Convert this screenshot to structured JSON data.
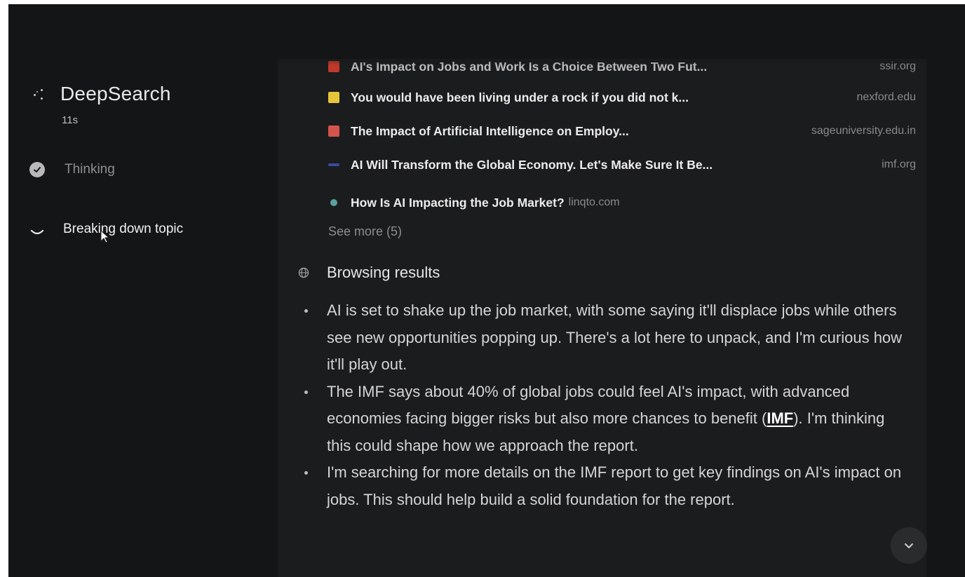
{
  "sidebar": {
    "app_title": "DeepSearch",
    "elapsed": "11s",
    "steps": [
      {
        "label": "Thinking",
        "state": "done"
      },
      {
        "label": "Breaking down topic",
        "state": "in-progress"
      }
    ]
  },
  "sources": [
    {
      "title": "AI's Impact on Jobs and Work Is a Choice Between Two Fut...",
      "domain": "ssir.org",
      "favicon_color": "#c0392b"
    },
    {
      "title": "You would have been living under a rock if you did not k...",
      "domain": "nexford.edu",
      "favicon_color": "#e7c53a"
    },
    {
      "title": "The Impact of Artificial Intelligence on Employ...",
      "domain": "sageuniversity.edu.in",
      "favicon_color": "#d4534a"
    },
    {
      "title": "AI Will Transform the Global Economy. Let's Make Sure It Be...",
      "domain": "imf.org",
      "favicon_color": "#3b4aa0"
    },
    {
      "title": "How Is AI Impacting the Job Market?",
      "domain": "linqto.com",
      "favicon_color": "#5aa0a0"
    }
  ],
  "see_more": "See more (5)",
  "browsing": {
    "label": "Browsing results",
    "icon": "globe-icon"
  },
  "bullets": [
    {
      "text": "AI is set to shake up the job market, with some saying it'll displace jobs while others see new opportunities popping up. There's a lot here to unpack, and I'm curious how it'll play out."
    },
    {
      "before": "The IMF says about 40% of global jobs could feel AI's impact, with advanced economies facing bigger risks but also more chances to benefit (",
      "cite": "IMF",
      "after": "). I'm thinking this could shape how we approach the report."
    },
    {
      "text": "I'm searching for more details on the IMF report to get key findings on AI's impact on jobs. This should help build a solid foundation for the report."
    }
  ],
  "controls": {
    "scroll_down_icon": "chevron-down-icon"
  },
  "colors": {
    "background": "#141516",
    "card": "#1b1c1e",
    "text_primary": "#ececec",
    "text_muted": "#8a8a8a"
  }
}
